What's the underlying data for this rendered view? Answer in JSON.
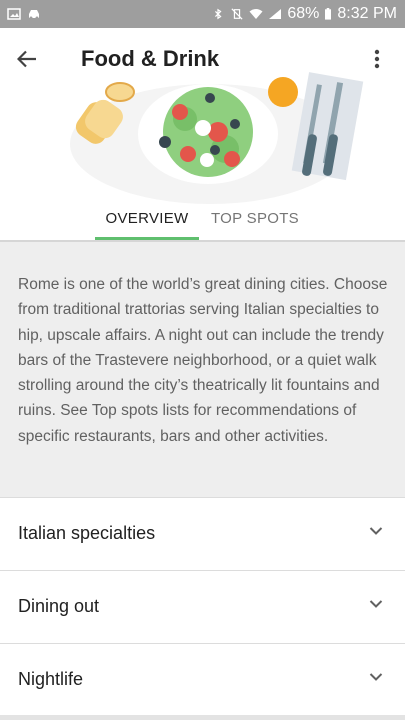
{
  "status_bar": {
    "battery": "68%",
    "time": "8:32 PM"
  },
  "header": {
    "title": "Food & Drink"
  },
  "tabs": [
    {
      "label": "OVERVIEW"
    },
    {
      "label": "TOP SPOTS"
    }
  ],
  "description": "Rome is one of the world’s great dining cities. Choose from traditional trattorias serving Italian specialties to hip, upscale affairs. A night out can include the trendy bars of the Trastevere neighborhood, or a quiet walk strolling around the city’s theatrically lit fountains and ruins. See Top spots lists for recommendations of specific restaurants, bars and other activities.",
  "sections": [
    {
      "label": "Italian specialties"
    },
    {
      "label": "Dining out"
    },
    {
      "label": "Nightlife"
    }
  ],
  "colors": {
    "accent": "#5fbf6e",
    "status_bar": "#9e9e9e"
  }
}
